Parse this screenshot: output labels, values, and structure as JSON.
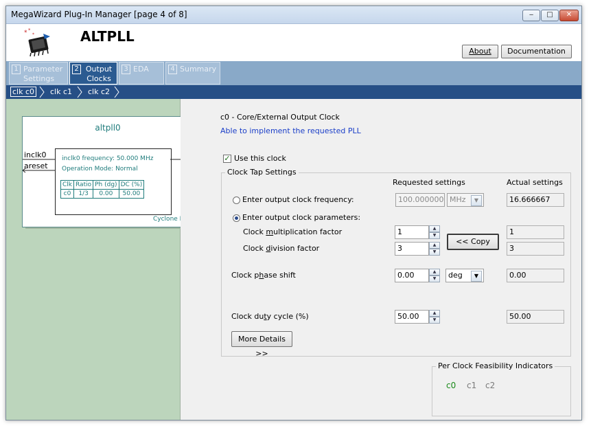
{
  "window": {
    "title": "MegaWizard Plug-In Manager [page 4 of 8]",
    "minimize_glyph": "‒",
    "maximize_glyph": "□",
    "close_glyph": "✕"
  },
  "header": {
    "app_title": "ALTPLL",
    "logo_icon": "megawizard-chip-icon",
    "about_label": "About",
    "documentation_label": "Documentation"
  },
  "tabs": [
    {
      "num": "1",
      "label": "Parameter Settings"
    },
    {
      "num": "2",
      "label": "Output Clocks"
    },
    {
      "num": "3",
      "label": "EDA"
    },
    {
      "num": "4",
      "label": "Summary"
    }
  ],
  "clock_tabs": [
    {
      "label": "clk c0"
    },
    {
      "label": "clk c1"
    },
    {
      "label": "clk c2"
    }
  ],
  "block": {
    "instance_name": "altpll0",
    "input_inclk": "inclk0",
    "input_areset": "areset",
    "output_c0": "c0",
    "freq_text": "inclk0 frequency: 50.000 MHz",
    "mode_text": "Operation Mode: Normal",
    "table_headers": [
      "Clk",
      "Ratio",
      "Ph (dg)",
      "DC (%)"
    ],
    "table_row": [
      "c0",
      "1/3",
      "0.00",
      "50.00"
    ],
    "device": "Cyclone II"
  },
  "panel": {
    "heading": "c0 - Core/External Output Clock",
    "status": "Able to implement the requested PLL",
    "use_clock_label": "Use this clock",
    "use_clock_checked": true,
    "group_title": "Clock Tap Settings",
    "requested_header": "Requested settings",
    "actual_header": "Actual settings",
    "opt_freq_label": "Enter output clock frequency:",
    "opt_freq_value": "100.00000000",
    "opt_freq_unit": "MHz",
    "opt_freq_actual": "16.666667",
    "opt_params_label": "Enter output clock parameters:",
    "mult_label_pre": "Clock ",
    "mult_label_u": "m",
    "mult_label_post": "ultiplication factor",
    "mult_value": "1",
    "mult_actual": "1",
    "div_label_pre": "Clock ",
    "div_label_u": "d",
    "div_label_post": "ivision factor",
    "div_value": "3",
    "div_actual": "3",
    "copy_label": "<< Copy",
    "phase_label_pre": "Clock p",
    "phase_label_u": "h",
    "phase_label_post": "ase shift",
    "phase_value": "0.00",
    "phase_unit": "deg",
    "phase_actual": "0.00",
    "duty_label_pre": "Clock du",
    "duty_label_u": "t",
    "duty_label_post": "y cycle (%)",
    "duty_value": "50.00",
    "duty_actual": "50.00",
    "more_details_label": "More Details >>",
    "feasibility_title": "Per Clock Feasibility Indicators",
    "indicators": [
      "c0",
      "c1",
      "c2"
    ],
    "indicator_colors": {
      "ok": "#1a8a1a",
      "inactive": "#7a7a7a"
    }
  }
}
